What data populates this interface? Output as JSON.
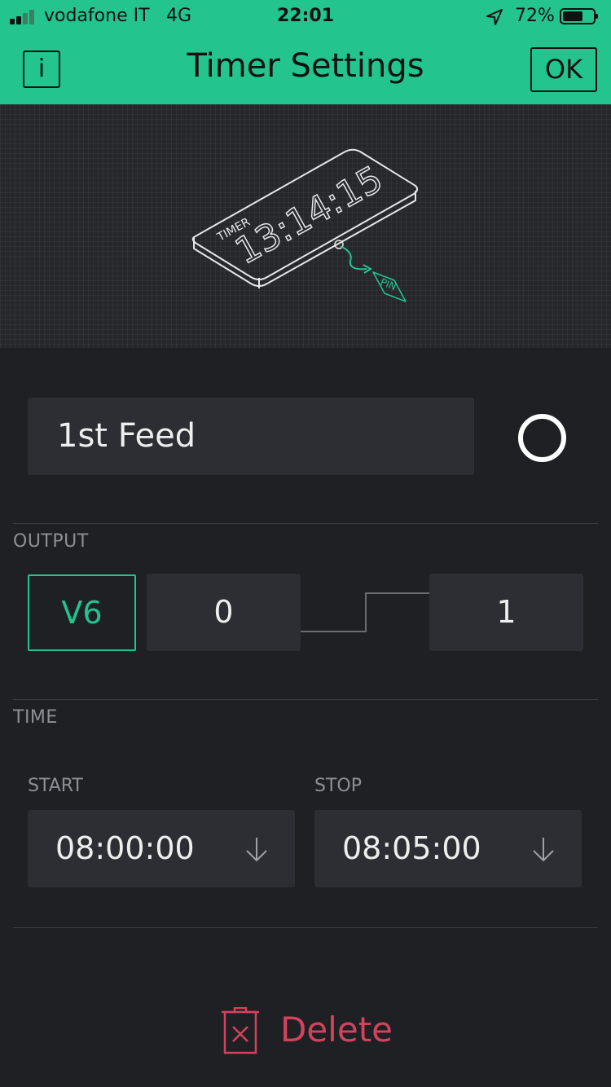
{
  "status_bar": {
    "carrier": "vodafone IT",
    "network": "4G",
    "time": "22:01",
    "battery_percent": "72%",
    "battery_level": 0.72
  },
  "header": {
    "info_label": "i",
    "title": "Timer Settings",
    "ok_label": "OK"
  },
  "illustration": {
    "device_label": "TIMER",
    "device_time": "13:14:15",
    "pin_label": "PIN"
  },
  "name_field": {
    "value": "1st Feed"
  },
  "output": {
    "section_label": "OUTPUT",
    "pin": "V6",
    "low_value": "0",
    "high_value": "1"
  },
  "time": {
    "section_label": "TIME",
    "start_label": "START",
    "start_value": "08:00:00",
    "stop_label": "STOP",
    "stop_value": "08:05:00"
  },
  "delete": {
    "label": "Delete"
  },
  "colors": {
    "accent": "#23c48e",
    "background": "#1f2024",
    "field": "#2d2e33",
    "danger": "#d3435c"
  }
}
